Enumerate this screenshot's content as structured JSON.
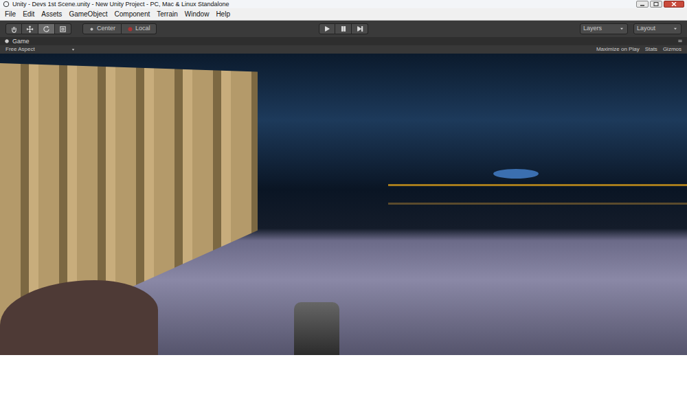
{
  "window": {
    "title": "Unity - Devs 1st Scene.unity - New Unity Project - PC, Mac & Linux Standalone"
  },
  "menu": [
    "File",
    "Edit",
    "Assets",
    "GameObject",
    "Component",
    "Terrain",
    "Window",
    "Help"
  ],
  "tools": [
    {
      "kind": "hand",
      "selected": false
    },
    {
      "kind": "move",
      "selected": false
    },
    {
      "kind": "rotate",
      "selected": true
    },
    {
      "kind": "scale",
      "selected": false
    }
  ],
  "pivot": {
    "center": "Center",
    "local": "Local"
  },
  "playback": {
    "playing": false,
    "paused": false
  },
  "layers": "Layers",
  "layout": "Layout",
  "game_panel": {
    "tab": "Game",
    "aspect": "Free Aspect",
    "options": [
      "Maximize on Play",
      "Stats",
      "Gizmos"
    ]
  }
}
